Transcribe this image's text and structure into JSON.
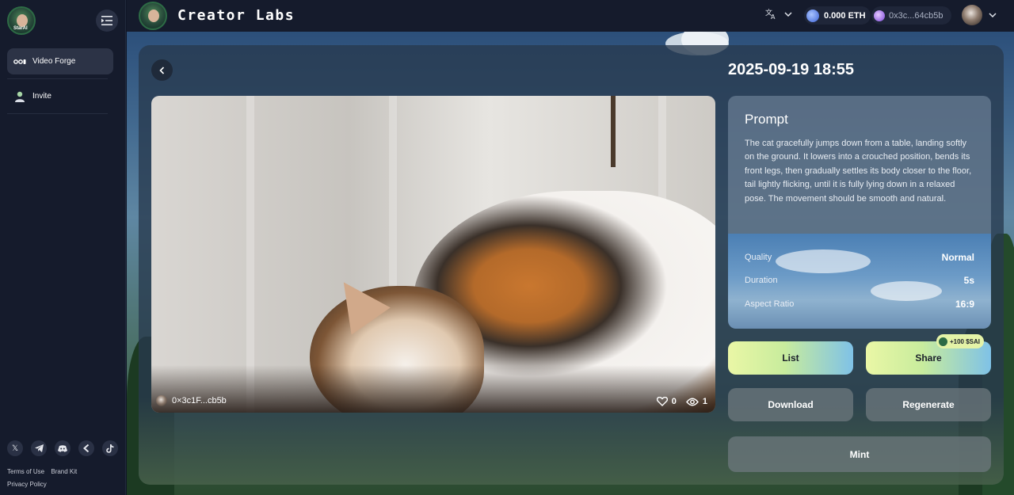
{
  "app": {
    "title": "Creator Labs"
  },
  "sidebar": {
    "avatar_tag": "StarAI",
    "items": [
      {
        "label": "Video Forge",
        "icon": "video-icon",
        "active": true
      },
      {
        "label": "Invite",
        "icon": "user-icon",
        "active": false
      }
    ],
    "socials": [
      "x-icon",
      "telegram-icon",
      "discord-icon",
      "back-icon",
      "tiktok-icon"
    ],
    "legal": {
      "terms": "Terms of Use",
      "brand": "Brand Kit",
      "privacy": "Privacy Policy"
    }
  },
  "topbar": {
    "balance": "0.000 ETH",
    "wallet": "0x3c...64cb5b"
  },
  "video": {
    "owner": "0×3c1F...cb5b",
    "likes": "0",
    "views": "1"
  },
  "detail": {
    "date": "2025-09-19 18:55",
    "prompt_title": "Prompt",
    "prompt_text": "The cat gracefully jumps down from a table, landing softly on the ground. It lowers into a crouched position, bends its front legs, then gradually settles its body closer to the floor, tail lightly flicking, until it is fully lying down in a relaxed pose. The movement should be smooth and natural.",
    "specs": [
      {
        "key": "Quality",
        "value": "Normal"
      },
      {
        "key": "Duration",
        "value": "5s"
      },
      {
        "key": "Aspect Ratio",
        "value": "16:9"
      }
    ]
  },
  "actions": {
    "list": "List",
    "share": "Share",
    "share_badge": "+100 $SAI",
    "download": "Download",
    "regenerate": "Regenerate",
    "mint": "Mint"
  },
  "colors": {
    "sidebar_bg": "#151b2c",
    "accent_gradient_start": "#eaf7a6",
    "accent_gradient_end": "#7fc2e7"
  }
}
